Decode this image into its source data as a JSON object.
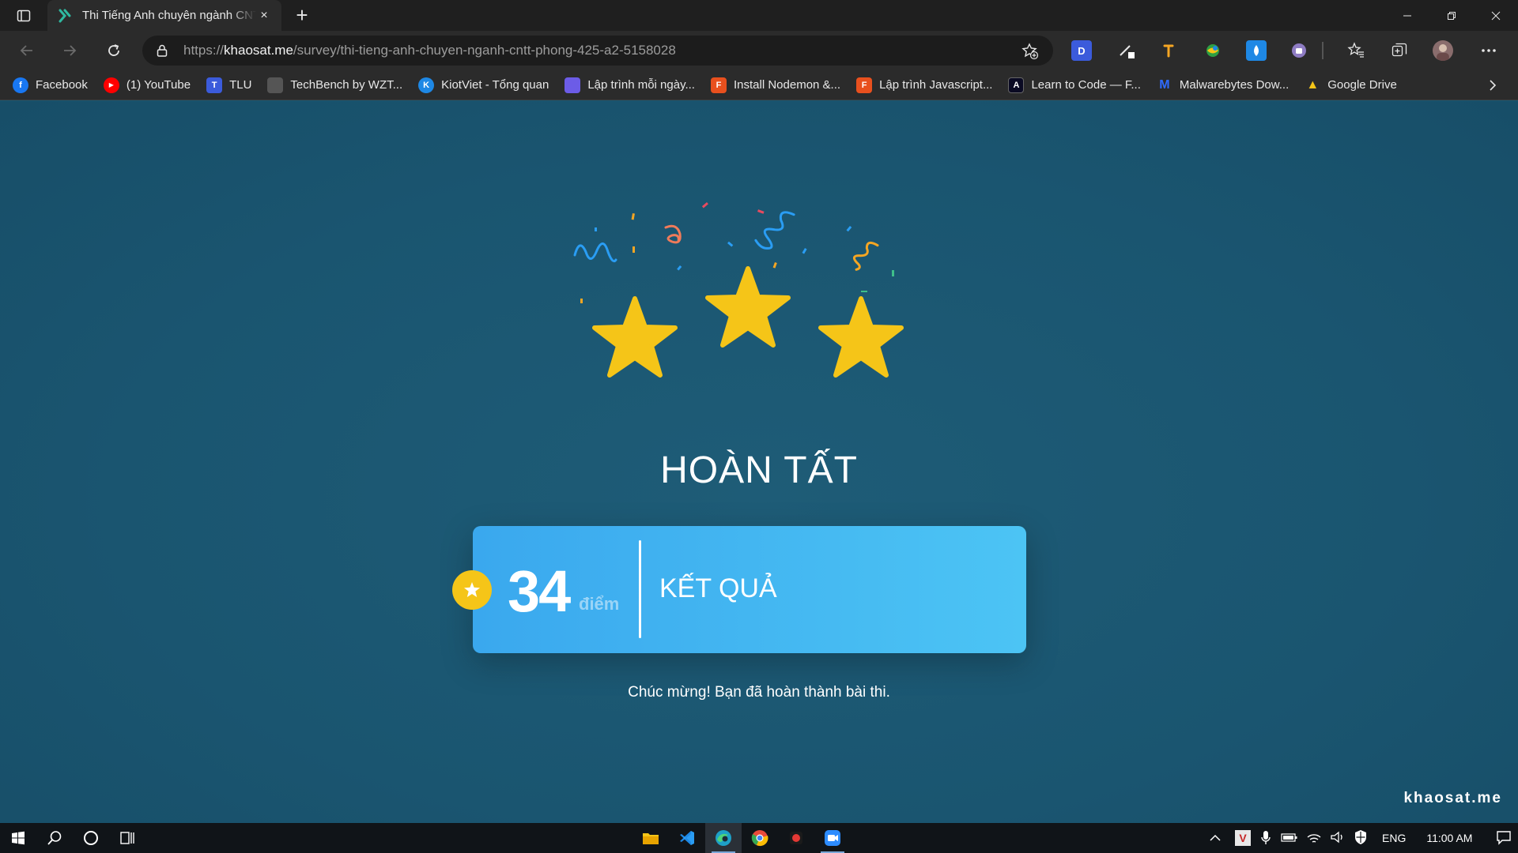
{
  "browser": {
    "tab": {
      "title": "Thi Tiếng Anh chuyên ngành CNTT",
      "close": "×"
    },
    "new_tab": "+",
    "address": {
      "scheme": "https://",
      "host": "khaosat.me",
      "path": "/survey/thi-tieng-anh-chuyen-nganh-cntt-phong-425-a2-5158028"
    },
    "extensions": [
      {
        "name": "d-extension-icon",
        "label": "D",
        "color": "#3b5bdb"
      },
      {
        "name": "pen-extension-icon",
        "label": "",
        "color": "#2b2b2b"
      },
      {
        "name": "tool-extension-icon",
        "label": "",
        "color": "#2b2b2b"
      },
      {
        "name": "globe-extension-icon",
        "label": "",
        "color": "#2b2b2b"
      },
      {
        "name": "drop-extension-icon",
        "label": "",
        "color": "#1e88e5"
      },
      {
        "name": "purple-extension-icon",
        "label": "",
        "color": "#2b2b2b"
      }
    ],
    "bookmarks": [
      {
        "label": "Facebook",
        "icon": "facebook-icon",
        "color": "#1877f2",
        "glyph": "f"
      },
      {
        "label": "(1) YouTube",
        "icon": "youtube-icon",
        "color": "#ff0000",
        "glyph": "▶"
      },
      {
        "label": "TLU",
        "icon": "tlu-icon",
        "color": "#3b5bdb",
        "glyph": "T"
      },
      {
        "label": "TechBench by WZT...",
        "icon": "techbench-icon",
        "color": "#555555",
        "glyph": ""
      },
      {
        "label": "KiotViet - Tổng quan",
        "icon": "kiotviet-icon",
        "color": "#1e88e5",
        "glyph": "K"
      },
      {
        "label": "Lập trình mỗi ngày...",
        "icon": "lap-trinh-icon",
        "color": "#6c5ce7",
        "glyph": ""
      },
      {
        "label": "Install Nodemon &...",
        "icon": "f8-icon",
        "color": "#e8501e",
        "glyph": "F"
      },
      {
        "label": "Lập trình Javascript...",
        "icon": "f8-icon-2",
        "color": "#e8501e",
        "glyph": "F"
      },
      {
        "label": "Learn to Code — F...",
        "icon": "freecodecamp-icon",
        "color": "#0a0a23",
        "glyph": "A"
      },
      {
        "label": "Malwarebytes Dow...",
        "icon": "malwarebytes-icon",
        "color": "#2b2b2b",
        "glyph": "M"
      },
      {
        "label": "Google Drive",
        "icon": "google-drive-icon",
        "color": "#2b2b2b",
        "glyph": "▲"
      }
    ]
  },
  "page": {
    "title": "HOÀN TẤT",
    "score": "34",
    "score_unit": "điểm",
    "result_label": "KẾT QUẢ",
    "congrats": "Chúc mừng! Bạn đã hoàn thành bài thi.",
    "brand": "khaosat.me",
    "stars": 3
  },
  "taskbar": {
    "language": "ENG",
    "time": "11:00 AM"
  },
  "colors": {
    "page_bg": "#1b5670",
    "star": "#f5c518",
    "card_start": "#3aa8ee",
    "card_end": "#4cc4f4"
  }
}
